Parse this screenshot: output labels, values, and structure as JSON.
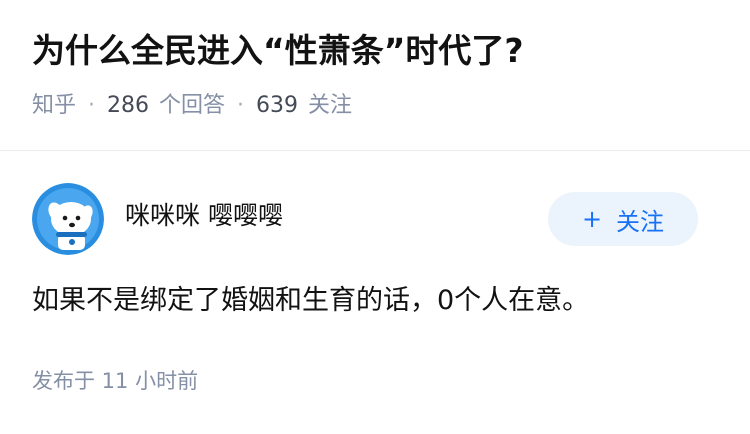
{
  "question": {
    "title": "为什么全民进入“性萧条”时代了?",
    "source": "知乎",
    "separator": "·",
    "answers_count": "286",
    "answers_label": "个回答",
    "followers_count": "639",
    "followers_label": "关注"
  },
  "answer": {
    "author": {
      "name": "咪咪咪 嘤嘤嘤",
      "avatar_icon": "cartoon-dog-avatar-icon"
    },
    "follow_button": {
      "icon": "+",
      "label": "关注"
    },
    "content": "如果不是绑定了婚姻和生育的话，0个人在意。",
    "publish_time": "发布于  11 小时前"
  },
  "colors": {
    "title_text": "#121212",
    "meta_gray": "#8590a6",
    "accent_blue": "#1772f6",
    "follow_bg": "#ebf3fc",
    "avatar_blue": "#2a8ee0",
    "divider": "#ececec"
  }
}
